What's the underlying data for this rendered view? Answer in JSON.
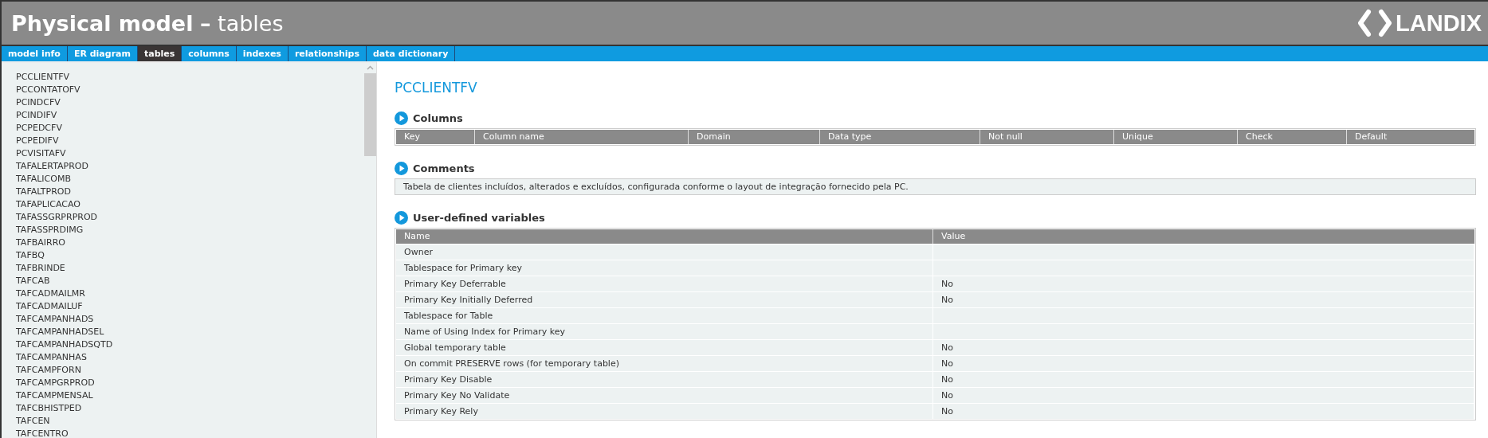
{
  "header": {
    "title": "Physical model",
    "separator": "–",
    "subtitle": "tables",
    "logo": "LANDIX"
  },
  "tabs": [
    {
      "label": "model info",
      "selected": false
    },
    {
      "label": "ER diagram",
      "selected": false
    },
    {
      "label": "tables",
      "selected": true
    },
    {
      "label": "columns",
      "selected": false
    },
    {
      "label": "indexes",
      "selected": false
    },
    {
      "label": "relationships",
      "selected": false
    },
    {
      "label": "data dictionary",
      "selected": false
    }
  ],
  "sidebar": {
    "items": [
      "PCCLIENTFV",
      "PCCONTATOFV",
      "PCINDCFV",
      "PCINDIFV",
      "PCPEDCFV",
      "PCPEDIFV",
      "PCVISITAFV",
      "TAFALERTAPROD",
      "TAFALICOMB",
      "TAFALTPROD",
      "TAFAPLICACAO",
      "TAFASSGRPRPROD",
      "TAFASSPRDIMG",
      "TAFBAIRRO",
      "TAFBQ",
      "TAFBRINDE",
      "TAFCAB",
      "TAFCADMAILMR",
      "TAFCADMAILUF",
      "TAFCAMPANHADS",
      "TAFCAMPANHADSEL",
      "TAFCAMPANHADSQTD",
      "TAFCAMPANHAS",
      "TAFCAMPFORN",
      "TAFCAMPGRPROD",
      "TAFCAMPMENSAL",
      "TAFCBHISTPED",
      "TAFCEN",
      "TAFCENTRO"
    ]
  },
  "content": {
    "table_name": "PCCLIENTFV",
    "columns_section": {
      "heading": "Columns",
      "columns": [
        "Key",
        "Column name",
        "Domain",
        "Data type",
        "Not null",
        "Unique",
        "Check",
        "Default"
      ]
    },
    "comments_section": {
      "heading": "Comments",
      "text": "Tabela de clientes incluídos, alterados e excluídos, configurada conforme o layout de integração fornecido pela PC."
    },
    "variables_section": {
      "heading": "User-defined variables",
      "columns": [
        "Name",
        "Value"
      ],
      "rows": [
        {
          "name": "Owner",
          "value": ""
        },
        {
          "name": "Tablespace for Primary key",
          "value": ""
        },
        {
          "name": "Primary Key Deferrable",
          "value": "No"
        },
        {
          "name": "Primary Key Initially Deferred",
          "value": "No"
        },
        {
          "name": "Tablespace for Table",
          "value": ""
        },
        {
          "name": "Name of Using Index for Primary key",
          "value": ""
        },
        {
          "name": "Global temporary table",
          "value": "No"
        },
        {
          "name": "On commit PRESERVE rows (for temporary table)",
          "value": "No"
        },
        {
          "name": "Primary Key Disable",
          "value": "No"
        },
        {
          "name": "Primary Key No Validate",
          "value": "No"
        },
        {
          "name": "Primary Key Rely",
          "value": "No"
        }
      ]
    }
  }
}
